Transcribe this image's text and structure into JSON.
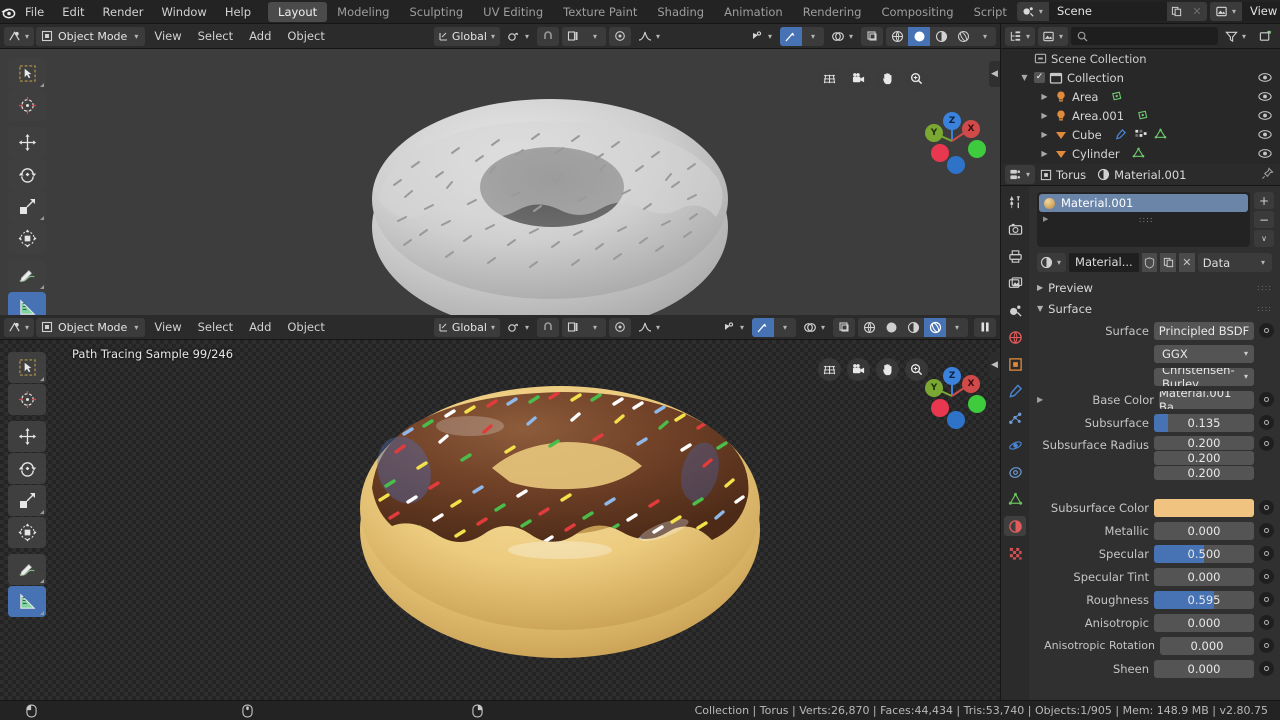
{
  "topbar": {
    "logo_icon": "blender-logo-icon",
    "menus": [
      "File",
      "Edit",
      "Render",
      "Window",
      "Help"
    ],
    "workspace_tabs": [
      {
        "label": "Layout",
        "active": true
      },
      {
        "label": "Modeling",
        "active": false
      },
      {
        "label": "Sculpting",
        "active": false
      },
      {
        "label": "UV Editing",
        "active": false
      },
      {
        "label": "Texture Paint",
        "active": false
      },
      {
        "label": "Shading",
        "active": false
      },
      {
        "label": "Animation",
        "active": false
      },
      {
        "label": "Rendering",
        "active": false
      },
      {
        "label": "Compositing",
        "active": false
      },
      {
        "label": "Script",
        "active": false
      }
    ],
    "scene": {
      "name": "Scene",
      "icon": "scene-icon",
      "copy_icon": "duplicate-icon",
      "close_icon": "x-icon"
    },
    "view_layer": {
      "name": "View Layer",
      "icon": "view-layer-icon",
      "copy_icon": "duplicate-icon",
      "close_icon": "x-icon"
    }
  },
  "viewport_top": {
    "editor_icon": "editor-type-icon",
    "mode": "Object Mode",
    "menus": [
      "View",
      "Select",
      "Add",
      "Object"
    ],
    "transform_orientation": "Global",
    "snap_icon": "magnet-icon",
    "pivot_icon": "pivot-icon",
    "proportional_icon": "proportional-editing-icon",
    "shading_modes": [
      {
        "name": "wireframe-shading",
        "active": false
      },
      {
        "name": "solid-shading",
        "active": true
      },
      {
        "name": "material-preview-shading",
        "active": false
      },
      {
        "name": "rendered-shading",
        "active": false
      }
    ],
    "overlay_icons": [
      "visibility-icon",
      "gizmo-icon",
      "overlays-icon",
      "xray-icon"
    ],
    "nav_icons": [
      "grid-icon",
      "camera-icon",
      "hand-icon",
      "zoom-icon"
    ],
    "gizmo_axes": [
      {
        "label": "Z",
        "color": "#3b82dd"
      },
      {
        "label": "X",
        "color": "#d04a4a"
      },
      {
        "label": "Y",
        "color": "#7aa832"
      }
    ],
    "tools": [
      {
        "name": "tweak-tool",
        "active": false
      },
      {
        "name": "cursor-tool",
        "active": false
      },
      {
        "name": "move-tool",
        "active": false
      },
      {
        "name": "rotate-tool",
        "active": false
      },
      {
        "name": "scale-tool",
        "active": false
      },
      {
        "name": "transform-tool",
        "active": false
      },
      {
        "name": "annotate-tool",
        "active": false
      },
      {
        "name": "measure-tool",
        "active": true
      }
    ]
  },
  "viewport_bottom": {
    "editor_icon": "editor-type-icon",
    "mode": "Object Mode",
    "menus": [
      "View",
      "Select",
      "Add",
      "Object"
    ],
    "transform_orientation": "Global",
    "render_status": "Path Tracing Sample 99/246",
    "pause_icon": "pause-icon",
    "shading_modes": [
      {
        "name": "wireframe-shading",
        "active": false
      },
      {
        "name": "solid-shading",
        "active": false
      },
      {
        "name": "material-preview-shading",
        "active": false
      },
      {
        "name": "rendered-shading",
        "active": true
      }
    ],
    "gizmo_axes": [
      {
        "label": "Z",
        "color": "#3b82dd"
      },
      {
        "label": "X",
        "color": "#d04a4a"
      },
      {
        "label": "Y",
        "color": "#7aa832"
      }
    ],
    "tools": [
      {
        "name": "tweak-tool",
        "active": false
      },
      {
        "name": "cursor-tool",
        "active": false
      },
      {
        "name": "move-tool",
        "active": false
      },
      {
        "name": "rotate-tool",
        "active": false
      },
      {
        "name": "scale-tool",
        "active": false
      },
      {
        "name": "transform-tool",
        "active": false
      },
      {
        "name": "annotate-tool",
        "active": false
      },
      {
        "name": "measure-tool",
        "active": true
      }
    ]
  },
  "outliner": {
    "display_mode_icon": "outliner-display-mode-icon",
    "filter_id_icon": "filter-id-icon",
    "search_placeholder": "",
    "search_icon": "search-icon",
    "filter_icon": "funnel-icon",
    "new_collection_icon": "new-collection-icon",
    "rows": [
      {
        "label": "Scene Collection",
        "icon": "scene-collection-icon",
        "indent": 0,
        "disclosure": "",
        "checkbox": false,
        "eye": false,
        "partial": true
      },
      {
        "label": "Collection",
        "icon": "collection-icon",
        "indent": 1,
        "disclosure": "down",
        "checkbox": true,
        "eye": true,
        "partial": false
      },
      {
        "label": "Area",
        "icon": "light-icon",
        "indent": 2,
        "disclosure": "right",
        "checkbox": false,
        "eye": true,
        "partial": false,
        "data_icons": [
          "light-data-icon"
        ]
      },
      {
        "label": "Area.001",
        "icon": "light-icon",
        "indent": 2,
        "disclosure": "right",
        "checkbox": false,
        "eye": true,
        "partial": false,
        "data_icons": [
          "light-data-icon"
        ]
      },
      {
        "label": "Cube",
        "icon": "mesh-object-icon",
        "indent": 2,
        "disclosure": "right",
        "checkbox": false,
        "eye": true,
        "partial": false,
        "data_icons": [
          "modifier-icon",
          "particles-icon",
          "mesh-data-icon"
        ]
      },
      {
        "label": "Cylinder",
        "icon": "mesh-object-icon",
        "indent": 2,
        "disclosure": "right",
        "checkbox": false,
        "eye": true,
        "partial": false,
        "data_icons": [
          "mesh-data-icon"
        ]
      }
    ]
  },
  "properties": {
    "breadcrumb": {
      "editor_icon": "properties-editor-icon",
      "object_icon": "object-icon",
      "object_name": "Torus",
      "material_icon": "material-icon",
      "material_name": "Material.001",
      "pin_icon": "pin-icon"
    },
    "tabs": [
      {
        "name": "tool-tab",
        "active": false,
        "color": "#cfcfcf"
      },
      {
        "name": "render-tab",
        "active": false,
        "color": "#cfcfcf"
      },
      {
        "name": "output-tab",
        "active": false,
        "color": "#cfcfcf"
      },
      {
        "name": "view-layer-tab",
        "active": false,
        "color": "#cfcfcf"
      },
      {
        "name": "scene-tab",
        "active": false,
        "color": "#cfcfcf"
      },
      {
        "name": "world-tab",
        "active": false,
        "color": "#e05b5b"
      },
      {
        "name": "object-tab",
        "active": false,
        "color": "#e0893b"
      },
      {
        "name": "modifier-tab",
        "active": false,
        "color": "#4a86d6"
      },
      {
        "name": "particles-tab",
        "active": false,
        "color": "#6f9ad4"
      },
      {
        "name": "physics-tab",
        "active": false,
        "color": "#4a86d6"
      },
      {
        "name": "constraints-tab",
        "active": false,
        "color": "#6f9ad4"
      },
      {
        "name": "data-tab",
        "active": false,
        "color": "#6bbf5e"
      },
      {
        "name": "material-tab",
        "active": true,
        "color": "#e05b5b"
      },
      {
        "name": "texture-tab",
        "active": false,
        "color": "#d05050"
      }
    ],
    "slot": {
      "name": "Material.001",
      "add_label": "+",
      "remove_label": "−",
      "menu_label": "∨"
    },
    "material_row": {
      "browse_icon": "browse-material-icon",
      "name": "Material...",
      "shield_icon": "fake-user-icon",
      "copy_icon": "new-material-icon",
      "unlink_icon": "unlink-icon",
      "link_value": "Data"
    },
    "panels": [
      {
        "label": "Preview",
        "open": false
      },
      {
        "label": "Surface",
        "open": true
      }
    ],
    "surface": {
      "rows": [
        {
          "label": "Surface",
          "type": "dropdown_value",
          "value": "Principled BSDF",
          "dot": true
        },
        {
          "label": "",
          "type": "dropdown",
          "value": "GGX"
        },
        {
          "label": "",
          "type": "dropdown",
          "value": "Christensen-Burley"
        },
        {
          "label": "Base Color",
          "type": "linked",
          "value": "Material.001 Ba..",
          "dot": true,
          "expand": true
        },
        {
          "label": "Subsurface",
          "type": "slider",
          "value": "0.135",
          "fill": 0.135,
          "dot": true
        },
        {
          "label": "Subsurface Radius",
          "type": "vector",
          "values": [
            "0.200",
            "0.200",
            "0.200"
          ],
          "dot": true
        },
        {
          "label": "Subsurface Color",
          "type": "color",
          "color": "#f0c380",
          "dot": true
        },
        {
          "label": "Metallic",
          "type": "slider",
          "value": "0.000",
          "fill": 0,
          "dot": true
        },
        {
          "label": "Specular",
          "type": "slider",
          "value": "0.500",
          "fill": 0.5,
          "dot": true
        },
        {
          "label": "Specular Tint",
          "type": "slider",
          "value": "0.000",
          "fill": 0,
          "dot": true
        },
        {
          "label": "Roughness",
          "type": "slider",
          "value": "0.595",
          "fill": 0.595,
          "dot": true
        },
        {
          "label": "Anisotropic",
          "type": "slider",
          "value": "0.000",
          "fill": 0,
          "dot": true
        },
        {
          "label": "Anisotropic Rotation",
          "type": "slider",
          "value": "0.000",
          "fill": 0,
          "dot": true
        },
        {
          "label": "Sheen",
          "type": "slider",
          "value": "0.000",
          "fill": 0,
          "dot": true
        }
      ]
    }
  },
  "statusbar": {
    "mouse_icons": [
      "left-mouse-icon",
      "middle-mouse-icon",
      "right-mouse-icon"
    ],
    "stats": "Collection | Torus | Verts:26,870 | Faces:44,434 | Tris:53,740 | Objects:1/905 | Mem: 148.9 MB | v2.80.75"
  }
}
